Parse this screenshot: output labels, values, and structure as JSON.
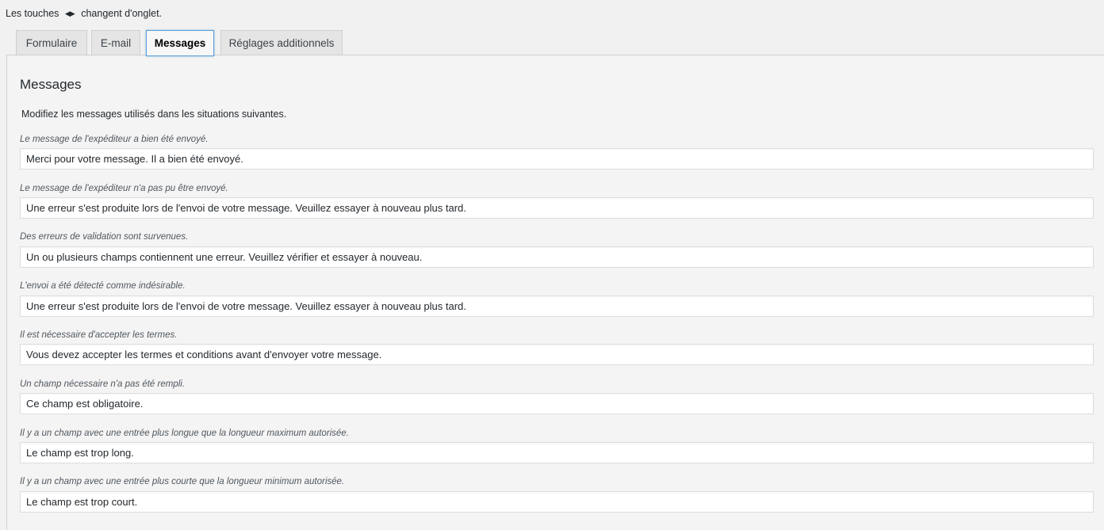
{
  "hint": {
    "before": "Les touches",
    "arrows": "◀▶",
    "after": "changent d'onglet."
  },
  "tabs": [
    {
      "label": "Formulaire",
      "active": false
    },
    {
      "label": "E-mail",
      "active": false
    },
    {
      "label": "Messages",
      "active": true
    },
    {
      "label": "Réglages additionnels",
      "active": false
    }
  ],
  "panel": {
    "title": "Messages",
    "intro": "Modifiez les messages utilisés dans les situations suivantes.",
    "fields": [
      {
        "label": "Le message de l'expéditeur a bien été envoyé.",
        "value": "Merci pour votre message. Il a bien été envoyé."
      },
      {
        "label": "Le message de l'expéditeur n'a pas pu être envoyé.",
        "value": "Une erreur s'est produite lors de l'envoi de votre message. Veuillez essayer à nouveau plus tard."
      },
      {
        "label": "Des erreurs de validation sont survenues.",
        "value": "Un ou plusieurs champs contiennent une erreur. Veuillez vérifier et essayer à nouveau."
      },
      {
        "label": "L'envoi a été détecté comme indésirable.",
        "value": "Une erreur s'est produite lors de l'envoi de votre message. Veuillez essayer à nouveau plus tard."
      },
      {
        "label": "Il est nécessaire d'accepter les termes.",
        "value": "Vous devez accepter les termes et conditions avant d'envoyer votre message."
      },
      {
        "label": "Un champ nécessaire n'a pas été rempli.",
        "value": "Ce champ est obligatoire."
      },
      {
        "label": "Il y a un champ avec une entrée plus longue que la longueur maximum autorisée.",
        "value": "Le champ est trop long."
      },
      {
        "label": "Il y a un champ avec une entrée plus courte que la longueur minimum autorisée.",
        "value": "Le champ est trop court."
      }
    ]
  }
}
